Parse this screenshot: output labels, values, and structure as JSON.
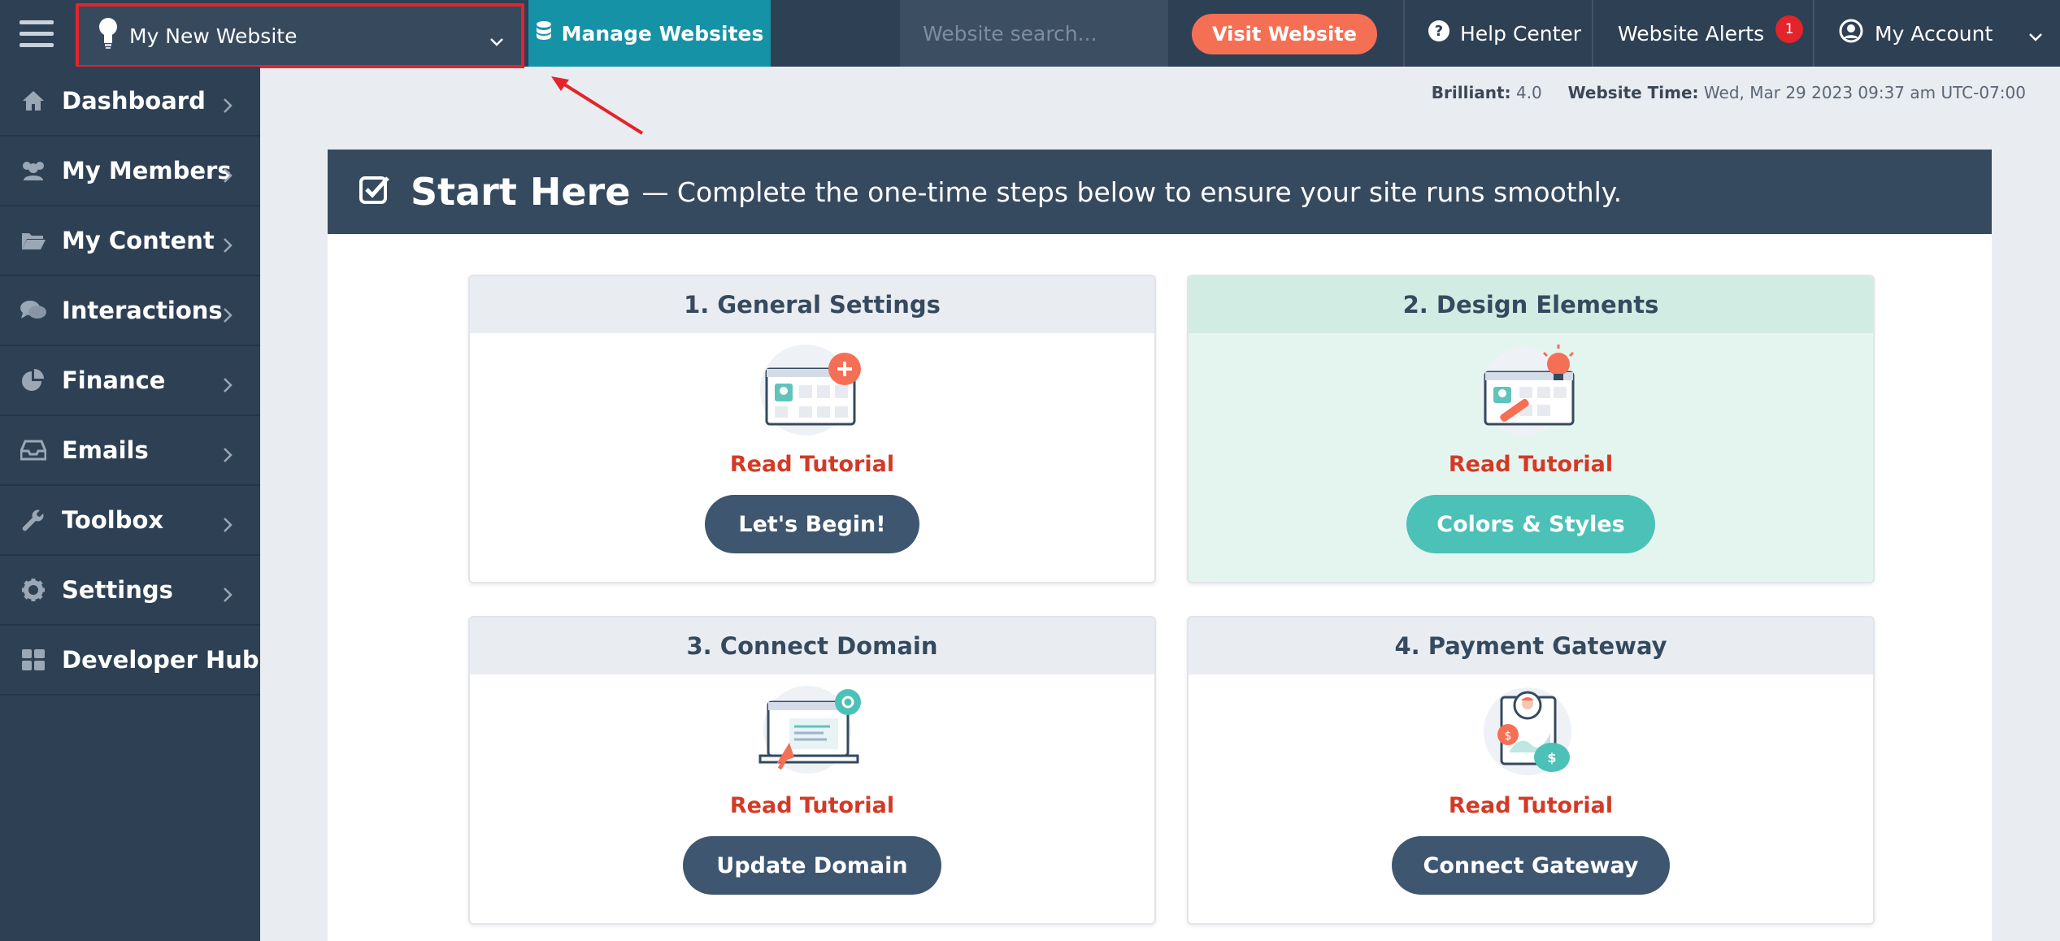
{
  "topbar": {
    "site_selector": "My New Website",
    "manage_label": "Manage Websites",
    "search_placeholder": "Website search...",
    "visit_label": "Visit Website",
    "help_label": "Help Center",
    "alerts_label": "Website Alerts",
    "alerts_count": "1",
    "account_label": "My Account"
  },
  "sidebar": {
    "items": [
      {
        "label": "Dashboard",
        "icon": "home-icon"
      },
      {
        "label": "My Members",
        "icon": "users-icon"
      },
      {
        "label": "My Content",
        "icon": "folder-open-icon"
      },
      {
        "label": "Interactions",
        "icon": "comments-icon"
      },
      {
        "label": "Finance",
        "icon": "pie-chart-icon"
      },
      {
        "label": "Emails",
        "icon": "inbox-icon"
      },
      {
        "label": "Toolbox",
        "icon": "wrench-icon"
      },
      {
        "label": "Settings",
        "icon": "gear-icon"
      },
      {
        "label": "Developer Hub",
        "icon": "grid-icon"
      }
    ]
  },
  "status": {
    "version_label": "Brilliant:",
    "version_value": "4.0",
    "time_label": "Website Time:",
    "time_value": "Wed, Mar 29 2023 09:37 am UTC-07:00"
  },
  "start": {
    "title": "Start Here",
    "subtitle": "— Complete the one-time steps below to ensure your site runs smoothly."
  },
  "cards": [
    {
      "title": "1. General Settings",
      "link": "Read Tutorial",
      "button": "Let's Begin!"
    },
    {
      "title": "2. Design Elements",
      "link": "Read Tutorial",
      "button": "Colors & Styles"
    },
    {
      "title": "3. Connect Domain",
      "link": "Read Tutorial",
      "button": "Update Domain"
    },
    {
      "title": "4. Payment Gateway",
      "link": "Read Tutorial",
      "button": "Connect Gateway"
    }
  ],
  "colors": {
    "navy": "#2e4054",
    "teal": "#1592a6",
    "coral": "#f56f55",
    "alert_red": "#e3242b",
    "mint": "#4bc1b7"
  }
}
